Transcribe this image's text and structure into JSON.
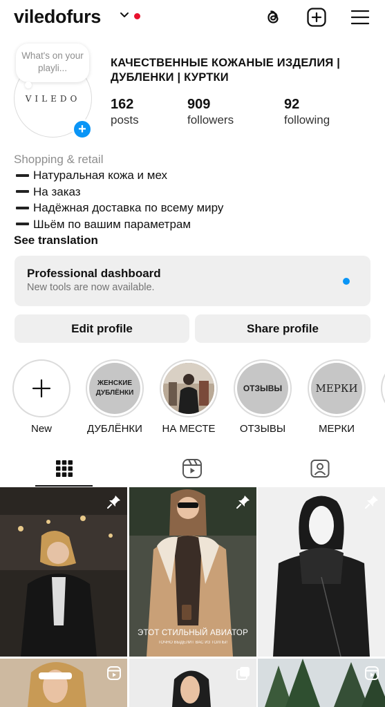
{
  "header": {
    "username": "viledofurs",
    "icons": [
      "chevron-down-icon",
      "threads-icon",
      "create-plus-icon",
      "menu-icon"
    ],
    "notification_dot_color": "#e8112d"
  },
  "profile": {
    "note": "What's on your playli...",
    "avatar_logo": "VILEDO",
    "business_name": "КАЧЕСТВЕННЫЕ КОЖАНЫЕ ИЗДЕЛИЯ | ДУБЛЕНКИ | КУРТКИ",
    "stats": [
      {
        "value": "162",
        "label": "posts"
      },
      {
        "value": "909",
        "label": "followers"
      },
      {
        "value": "92",
        "label": "following"
      }
    ]
  },
  "bio": {
    "category": "Shopping & retail",
    "lines": [
      "Натуральная кожа и мех",
      "На заказ",
      "Надёжная доставка по всему миру",
      "Шьём по вашим параметрам"
    ],
    "see_translation": "See translation"
  },
  "dashboard": {
    "title": "Professional dashboard",
    "subtitle": "New tools are now available.",
    "dot_color": "#0a95f6"
  },
  "buttons": {
    "edit": "Edit profile",
    "share": "Share profile"
  },
  "highlights": [
    {
      "label": "New",
      "inner": "+"
    },
    {
      "label": "ДУБЛЁНКИ",
      "inner": "ЖЕНСКИЕ ДУБЛЁНКИ"
    },
    {
      "label": "НА МЕСТЕ",
      "inner": ""
    },
    {
      "label": "ОТЗЫВЫ",
      "inner": "ОТЗЫВЫ"
    },
    {
      "label": "МЕРКИ",
      "inner": "МЕРКИ"
    }
  ],
  "tabs": [
    "grid-icon",
    "reels-icon",
    "tagged-icon"
  ],
  "posts": {
    "caption_main": "ЭТОТ СТИЛЬНЫЙ АВИАТОР",
    "caption_sub": "ТОЧНО ВЫДЕЛИТ ВАС ИЗ ТОЛПЫ!"
  }
}
